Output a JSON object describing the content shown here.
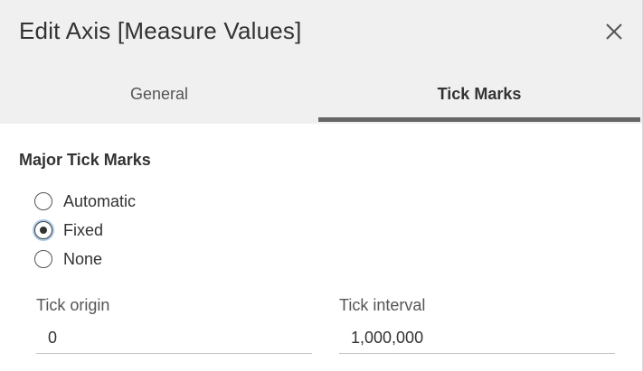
{
  "dialog": {
    "title": "Edit Axis [Measure Values]",
    "close_icon": "close-icon"
  },
  "tabs": [
    {
      "label": "General",
      "active": false
    },
    {
      "label": "Tick Marks",
      "active": true
    }
  ],
  "major_tick_marks": {
    "title": "Major Tick Marks",
    "options": [
      {
        "label": "Automatic",
        "selected": false
      },
      {
        "label": "Fixed",
        "selected": true
      },
      {
        "label": "None",
        "selected": false
      }
    ]
  },
  "fields": {
    "tick_origin": {
      "label": "Tick origin",
      "value": "0"
    },
    "tick_interval": {
      "label": "Tick interval",
      "value": "1,000,000"
    }
  },
  "colors": {
    "header_background": "#f0f0f0",
    "active_tab_underline": "#666666",
    "radio_focus_ring": "#a9c7e8"
  }
}
